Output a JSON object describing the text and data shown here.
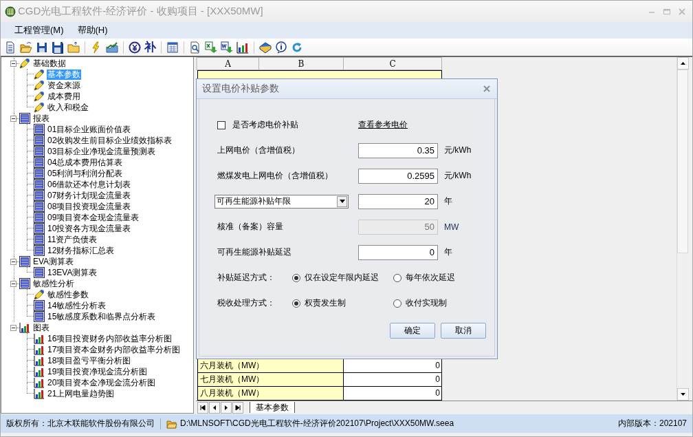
{
  "window": {
    "title": "CGD光电工程软件-经济评价 - 收购项目 - [XXX50MW]"
  },
  "menu": [
    "工程管理(M)",
    "帮助(H)"
  ],
  "toolbar": {
    "glyph": "补"
  },
  "tree": [
    {
      "label": "基础数据",
      "kind": "input",
      "expanded": true,
      "selected": false,
      "children": [
        {
          "label": "基本参数",
          "kind": "input",
          "selected": true
        },
        {
          "label": "资金来源",
          "kind": "input",
          "selected": false
        },
        {
          "label": "成本费用",
          "kind": "input",
          "selected": false
        },
        {
          "label": "收入和税金",
          "kind": "input",
          "selected": false
        }
      ]
    },
    {
      "label": "报表",
      "kind": "report",
      "expanded": true,
      "selected": false,
      "children": [
        {
          "label": "01目标企业账面价值表",
          "kind": "report",
          "selected": false
        },
        {
          "label": "02收购发生前目标企业绩效指标表",
          "kind": "report",
          "selected": false
        },
        {
          "label": "03目标企业净现金流量预测表",
          "kind": "report",
          "selected": false
        },
        {
          "label": "04总成本费用估算表",
          "kind": "report",
          "selected": false
        },
        {
          "label": "05利润与利润分配表",
          "kind": "report",
          "selected": false
        },
        {
          "label": "06借款还本付息计划表",
          "kind": "report",
          "selected": false
        },
        {
          "label": "07财务计划现金流量表",
          "kind": "report",
          "selected": false
        },
        {
          "label": "08项目投资现金流量表",
          "kind": "report",
          "selected": false
        },
        {
          "label": "09项目资本金现金流量表",
          "kind": "report",
          "selected": false
        },
        {
          "label": "10投资各方现金流量表",
          "kind": "report",
          "selected": false
        },
        {
          "label": "11资产负债表",
          "kind": "report",
          "selected": false
        },
        {
          "label": "12财务指标汇总表",
          "kind": "report",
          "selected": false
        }
      ]
    },
    {
      "label": "EVA测算表",
      "kind": "report",
      "expanded": true,
      "selected": false,
      "children": [
        {
          "label": "13EVA测算表",
          "kind": "report",
          "selected": false
        }
      ]
    },
    {
      "label": "敏感性分析",
      "kind": "report",
      "expanded": true,
      "selected": false,
      "children": [
        {
          "label": "敏感性参数",
          "kind": "input",
          "selected": false
        },
        {
          "label": "14敏感性分析表",
          "kind": "report",
          "selected": false
        },
        {
          "label": "15敏感度系数和临界点分析表",
          "kind": "report",
          "selected": false
        }
      ]
    },
    {
      "label": "图表",
      "kind": "chart",
      "expanded": true,
      "selected": false,
      "children": [
        {
          "label": "16项目投资财务内部收益率分析图",
          "kind": "chart",
          "selected": false
        },
        {
          "label": "17项目资本金财务内部收益率分析图",
          "kind": "chart",
          "selected": false
        },
        {
          "label": "18项目盈亏平衡分析图",
          "kind": "chart",
          "selected": false
        },
        {
          "label": "19项目投资净现金流分析图",
          "kind": "chart",
          "selected": false
        },
        {
          "label": "20项目资本金净现金流分析图",
          "kind": "chart",
          "selected": false
        },
        {
          "label": "21上网电量趋势图",
          "kind": "chart",
          "selected": false
        }
      ]
    }
  ],
  "sheet": {
    "columns": [
      "A",
      "B",
      "C"
    ],
    "rows": [
      {
        "label": "六月装机（MW）",
        "value": "0"
      },
      {
        "label": "七月装机（MW）",
        "value": "0"
      },
      {
        "label": "八月装机（MW）",
        "value": "0"
      }
    ],
    "tabs": [
      {
        "label": "基本参数",
        "selected": true
      }
    ]
  },
  "dialog": {
    "title": "设置电价补贴参数",
    "checkbox": {
      "label": "是否考虑电价补贴",
      "checked": false
    },
    "link": "查看参考电价",
    "fields": [
      {
        "kind": "text",
        "label": "上网电价（含增值税）",
        "value": "0.35",
        "unit": "元/kWh",
        "disabled": false
      },
      {
        "kind": "text",
        "label": "燃煤发电上网电价（含增值税）",
        "value": "0.2595",
        "unit": "元/kWh",
        "disabled": false
      },
      {
        "kind": "select",
        "label": "可再生能源补贴年限",
        "value": "20",
        "unit": "年",
        "disabled": false
      },
      {
        "kind": "text",
        "label": "核准（备案）容量",
        "value": "50",
        "unit": "MW",
        "disabled": true
      },
      {
        "kind": "text",
        "label": "可再生能源补贴延迟",
        "value": "0",
        "unit": "年",
        "disabled": false
      }
    ],
    "radio_groups": [
      {
        "label": "补贴延迟方式：",
        "options": [
          {
            "label": "仅在设定年限内延迟",
            "selected": true
          },
          {
            "label": "每年依次延迟",
            "selected": false
          }
        ]
      },
      {
        "label": "税收处理方式：",
        "options": [
          {
            "label": "权责发生制",
            "selected": true
          },
          {
            "label": "收付实现制",
            "selected": false
          }
        ]
      }
    ],
    "buttons": [
      "确定",
      "取消"
    ]
  },
  "status_bar": {
    "copyright": "版权所有：北京木联能软件股份有限公司",
    "path": "D:\\MLNSOFT\\CGD光电工程软件-经济评价202107\\Project\\XXX50MW.seea",
    "version": "内部版本：202107"
  }
}
